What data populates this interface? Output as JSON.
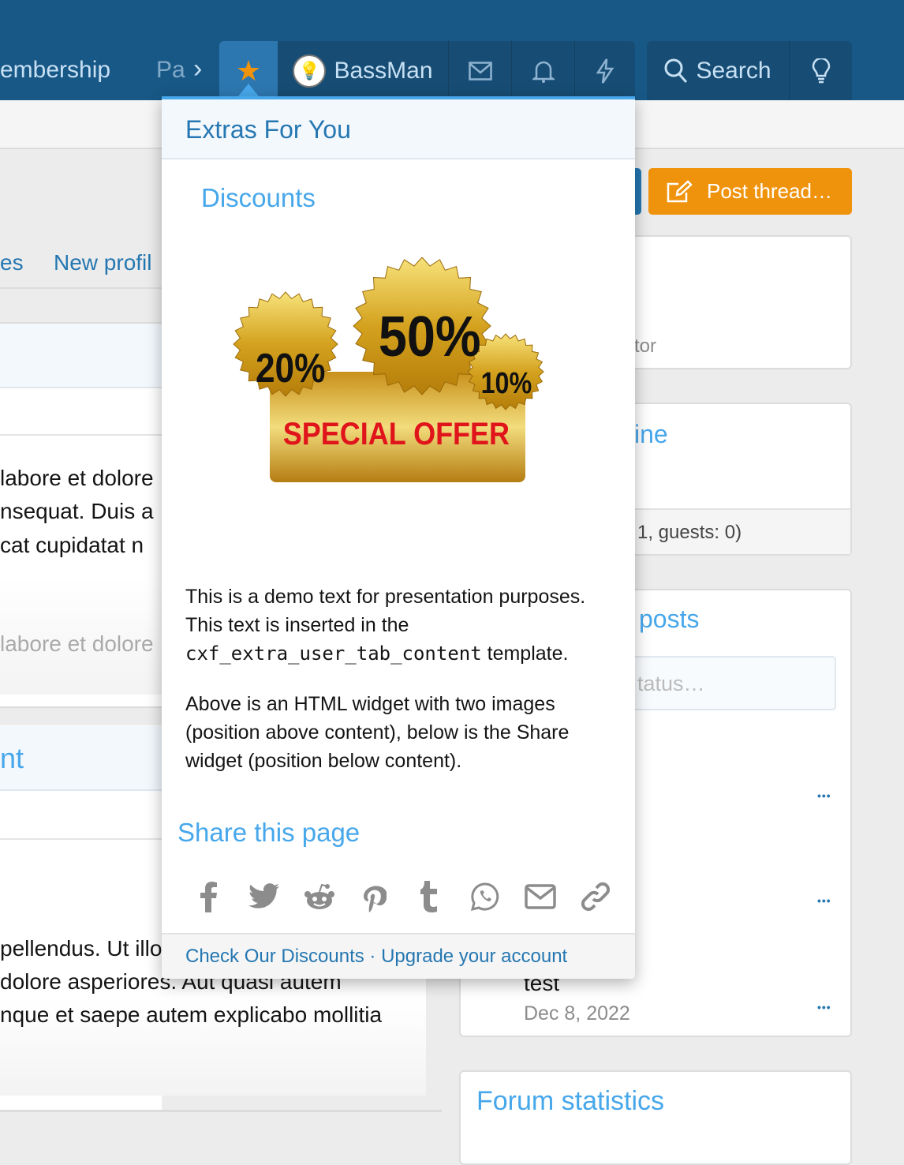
{
  "nav": {
    "membership": "embership",
    "partial": "Pa",
    "user": "BassMan",
    "search": "Search"
  },
  "subnav": {
    "tabs": [
      "es",
      "New profil"
    ]
  },
  "left": {
    "lines": [
      "labore et dolore",
      "nsequat. Duis a",
      "cat cupidatat n"
    ],
    "faded": "labore et dolore",
    "block_title": "nt",
    "lines2": [
      "pellendus. Ut illo",
      "dolore asperiores. Aut quasi autem",
      "nque et saepe autem explicabo mollitia"
    ]
  },
  "right": {
    "post_thread": "Post thread…",
    "card1_text": "tor",
    "card2_title": "ine",
    "card2_footer": "1, guests: 0)",
    "card3_title": "posts",
    "status_placeholder": "tatus…",
    "post_title": "test",
    "post_date": "Dec 8, 2022",
    "more": "•••",
    "stats_title": "Forum statistics"
  },
  "popup": {
    "title": "Extras For You",
    "discounts": "Discounts",
    "image": {
      "badges": [
        "20%",
        "50%",
        "10%"
      ],
      "banner": "SPECIAL OFFER"
    },
    "p1a": "This is a demo text for presentation purposes.",
    "p1b": "This text is inserted in the",
    "p1code": "cxf_extra_user_tab_content",
    "p1c": " template.",
    "p2": "Above is an HTML widget with two images (position above content), below is the Share widget (position below content).",
    "share_title": "Share this page",
    "share_icons": [
      "facebook-icon",
      "twitter-icon",
      "reddit-icon",
      "pinterest-icon",
      "tumblr-icon",
      "whatsapp-icon",
      "email-icon",
      "link-icon"
    ],
    "footer": {
      "link1": "Check Our Discounts",
      "sep": " · ",
      "link2": "Upgrade your account"
    }
  },
  "colors": {
    "nav": "#185886",
    "accent": "#47a7eb",
    "link": "#2577b1",
    "orange": "#f0930c"
  }
}
